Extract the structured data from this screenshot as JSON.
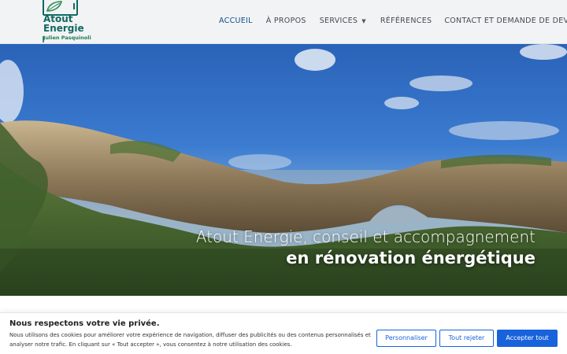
{
  "logo": {
    "name_line1": "Atout",
    "name_line2": "Energie",
    "subtitle": "Julien Pasquinoli"
  },
  "nav": {
    "items": [
      {
        "label": "ACCUEIL",
        "active": true
      },
      {
        "label": "À PROPOS"
      },
      {
        "label": "SERVICES",
        "has_dropdown": true,
        "dropdown_icon": "caret-down-icon"
      },
      {
        "label": "RÉFÉRENCES"
      },
      {
        "label": "CONTACT ET DEMANDE DE DEVIS"
      }
    ]
  },
  "hero": {
    "line1": "Atout Energie, conseil et accompagnement",
    "line2": "en rénovation énergétique"
  },
  "cookie_banner": {
    "title": "Nous respectons votre vie privée.",
    "text": "Nous utilisons des cookies pour améliorer votre expérience de navigation, diffuser des publicités ou des contenus personnalisés et analyser notre trafic. En cliquant sur « Tout accepter », vous consentez à notre utilisation des cookies.",
    "customize_label": "Personnaliser",
    "reject_label": "Tout rejeter",
    "accept_label": "Accepter tout"
  },
  "colors": {
    "nav_active": "#0f4f8a",
    "nav_text": "#444a52",
    "header_bg": "#f2f3f4",
    "logo_green": "#0f6a62",
    "button_blue": "#1863dc"
  }
}
